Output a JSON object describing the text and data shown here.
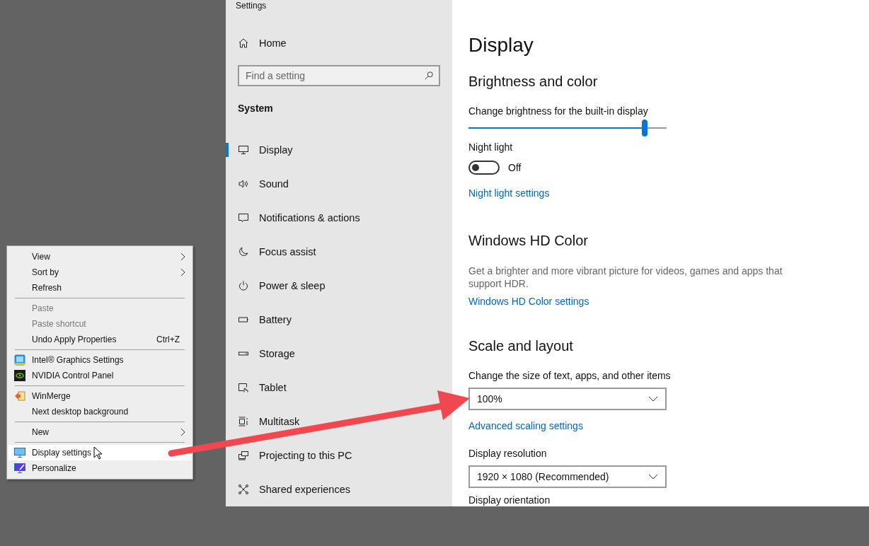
{
  "settings_window": {
    "title": "Settings",
    "sidebar": {
      "home": "Home",
      "search": {
        "placeholder": "Find a setting"
      },
      "section": "System",
      "items": [
        {
          "label": "Display",
          "selected": true
        },
        {
          "label": "Sound",
          "selected": false
        },
        {
          "label": "Notifications & actions",
          "selected": false
        },
        {
          "label": "Focus assist",
          "selected": false
        },
        {
          "label": "Power & sleep",
          "selected": false
        },
        {
          "label": "Battery",
          "selected": false
        },
        {
          "label": "Storage",
          "selected": false
        },
        {
          "label": "Tablet",
          "selected": false
        },
        {
          "label": "Multitask",
          "selected": false
        },
        {
          "label": "Projecting to this PC",
          "selected": false
        },
        {
          "label": "Shared experiences",
          "selected": false
        }
      ]
    },
    "content": {
      "page_title": "Display",
      "brightness_and_color": {
        "heading": "Brightness and color",
        "slider_label": "Change brightness for the built-in display",
        "brightness": {
          "level": 0.89
        },
        "night_light": {
          "label": "Night light",
          "on": false,
          "state_text": "Off"
        },
        "link": "Night light settings"
      },
      "hd_color": {
        "heading": "Windows HD Color",
        "description": "Get a brighter and more vibrant picture for videos, games and apps that support HDR.",
        "link": "Windows HD Color settings"
      },
      "scale_and_layout": {
        "heading": "Scale and layout",
        "scale_label": "Change the size of text, apps, and other items",
        "scale_value": "100%",
        "scale_link": "Advanced scaling settings",
        "resolution_label": "Display resolution",
        "resolution_value": "1920 × 1080 (Recommended)",
        "orientation_label": "Display orientation"
      }
    }
  },
  "context_menu": {
    "items": [
      {
        "kind": "item",
        "label": "View",
        "submenu": true,
        "disabled": false,
        "selected": false
      },
      {
        "kind": "item",
        "label": "Sort by",
        "submenu": true,
        "disabled": false,
        "selected": false
      },
      {
        "kind": "item",
        "label": "Refresh",
        "submenu": false,
        "disabled": false,
        "selected": false
      },
      {
        "kind": "separator"
      },
      {
        "kind": "item",
        "label": "Paste",
        "submenu": false,
        "disabled": true,
        "selected": false
      },
      {
        "kind": "item",
        "label": "Paste shortcut",
        "submenu": false,
        "disabled": true,
        "selected": false
      },
      {
        "kind": "item",
        "label": "Undo Apply Properties",
        "shortcut": "Ctrl+Z",
        "submenu": false,
        "disabled": false,
        "selected": false
      },
      {
        "kind": "separator"
      },
      {
        "kind": "item",
        "label": "Intel® Graphics Settings",
        "submenu": false,
        "disabled": false,
        "selected": false
      },
      {
        "kind": "item",
        "label": "NVIDIA Control Panel",
        "submenu": false,
        "disabled": false,
        "selected": false
      },
      {
        "kind": "separator"
      },
      {
        "kind": "item",
        "label": "WinMerge",
        "submenu": false,
        "disabled": false,
        "selected": false
      },
      {
        "kind": "item",
        "label": "Next desktop background",
        "submenu": false,
        "disabled": false,
        "selected": false
      },
      {
        "kind": "separator"
      },
      {
        "kind": "item",
        "label": "New",
        "submenu": true,
        "disabled": false,
        "selected": false
      },
      {
        "kind": "separator"
      },
      {
        "kind": "item",
        "label": "Display settings",
        "submenu": false,
        "disabled": false,
        "selected": true
      },
      {
        "kind": "item",
        "label": "Personalize",
        "submenu": false,
        "disabled": false,
        "selected": false
      }
    ]
  }
}
